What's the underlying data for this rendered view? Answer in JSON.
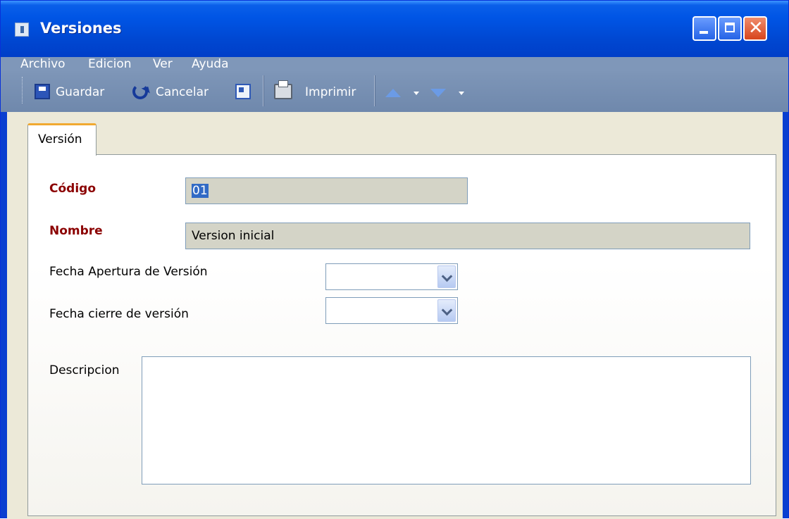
{
  "window": {
    "title": "Versiones",
    "controls": {
      "minimize": "minimize",
      "maximize": "maximize",
      "close": "✕"
    }
  },
  "menu": [
    "Archivo",
    "Edicion",
    "Ver",
    "Ayuda"
  ],
  "toolbar": {
    "save_label": "Guardar",
    "cancel_label": "Cancelar",
    "print_label": "Imprimir"
  },
  "tabs": [
    {
      "label": "Versión",
      "selected": true
    }
  ],
  "form": {
    "codigo_label": "Código",
    "codigo_value": "01",
    "nombre_label": "Nombre",
    "nombre_value": "Version inicial",
    "fecha_apertura_label": "Fecha Apertura de Versión",
    "fecha_apertura_value": "",
    "fecha_cierre_label": "Fecha cierre de versión",
    "fecha_cierre_value": "",
    "descripcion_label": "Descripcion",
    "descripcion_value": ""
  },
  "colors": {
    "title_bar": "#0055e5",
    "menu_toolbar_bg": "#7f97b9",
    "required_label": "#8b0000",
    "readonly_field": "#d4d4c7",
    "tab_highlight": "#f1a930"
  },
  "icons": [
    "document-icon",
    "save-icon",
    "undo-icon",
    "export-icon",
    "printer-icon",
    "arrow-up-icon",
    "arrow-down-icon"
  ]
}
